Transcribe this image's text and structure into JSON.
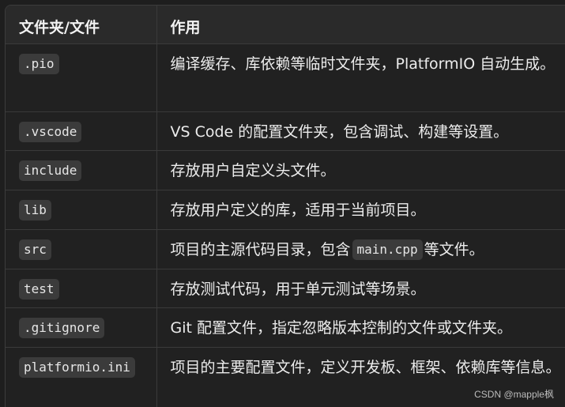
{
  "table": {
    "headers": [
      "文件夹/文件",
      "作用"
    ],
    "rows": [
      {
        "name": ".pio",
        "desc": "编译缓存、库依赖等临时文件夹，PlatformIO 自动生成。"
      },
      {
        "name": ".vscode",
        "desc": "VS Code 的配置文件夹，包含调试、构建等设置。"
      },
      {
        "name": "include",
        "desc": "存放用户自定义头文件。"
      },
      {
        "name": "lib",
        "desc": "存放用户定义的库，适用于当前项目。"
      },
      {
        "name": "src",
        "desc_before": "项目的主源代码目录，包含",
        "desc_code": "main.cpp",
        "desc_after": "等文件。"
      },
      {
        "name": "test",
        "desc": "存放测试代码，用于单元测试等场景。"
      },
      {
        "name": ".gitignore",
        "desc": "Git 配置文件，指定忽略版本控制的文件或文件夹。"
      },
      {
        "name": "platformio.ini",
        "desc": "项目的主要配置文件，定义开发板、框架、依赖库等信息。"
      }
    ]
  },
  "watermark": "CSDN @mapple枫"
}
